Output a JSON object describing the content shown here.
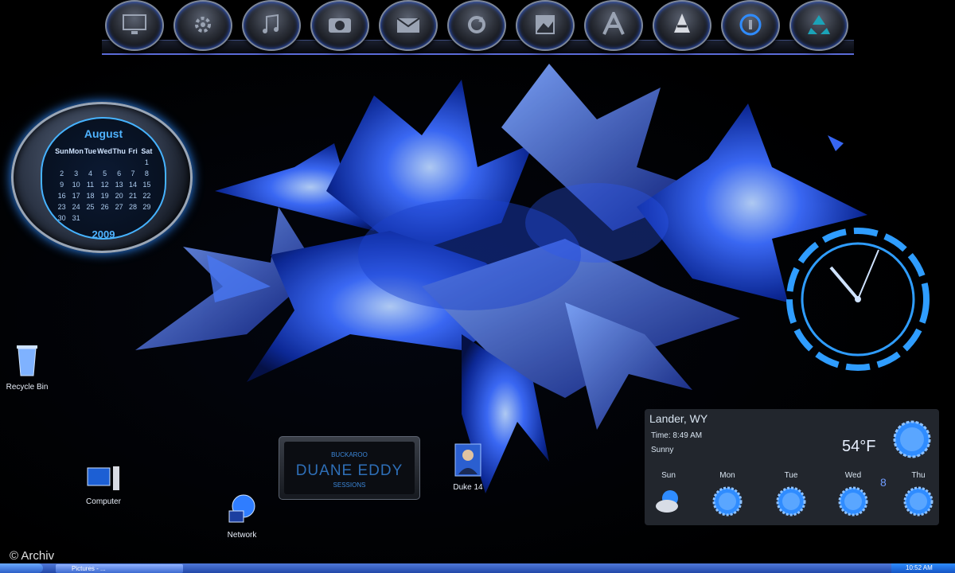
{
  "dock": {
    "items": [
      {
        "name": "monitor-icon"
      },
      {
        "name": "gear-icon"
      },
      {
        "name": "music-note-icon"
      },
      {
        "name": "camera-icon"
      },
      {
        "name": "mail-icon"
      },
      {
        "name": "refresh-icon"
      },
      {
        "name": "picture-icon"
      },
      {
        "name": "font-icon"
      },
      {
        "name": "vlc-cone-icon"
      },
      {
        "name": "info-icon"
      },
      {
        "name": "recycle-icon"
      }
    ]
  },
  "calendar": {
    "month": "August",
    "year": "2009",
    "weekdays": [
      "Sun",
      "Mon",
      "Tue",
      "Wed",
      "Thu",
      "Fri",
      "Sat"
    ],
    "days": [
      "",
      "",
      "",
      "",
      "",
      "",
      "1",
      "2",
      "3",
      "4",
      "5",
      "6",
      "7",
      "8",
      "9",
      "10",
      "11",
      "12",
      "13",
      "14",
      "15",
      "16",
      "17",
      "18",
      "19",
      "20",
      "21",
      "22",
      "23",
      "24",
      "25",
      "26",
      "27",
      "28",
      "29",
      "30",
      "31",
      "",
      "",
      "",
      "",
      ""
    ]
  },
  "desktop_icons": {
    "recycle_bin": "Recycle Bin",
    "computer": "Computer",
    "network": "Network",
    "duke": "Duke 14"
  },
  "nameplate": {
    "top": "BUCKAROO",
    "name": "DUANE EDDY",
    "bottom": "SESSIONS"
  },
  "weather": {
    "city": "Lander, WY",
    "time": "Time: 8:49 AM",
    "condition": "Sunny",
    "temperature": "54°F",
    "extra": "8",
    "forecast": [
      {
        "day": "Sun",
        "icon": "partly-cloudy-icon"
      },
      {
        "day": "Mon",
        "icon": "sun-icon"
      },
      {
        "day": "Tue",
        "icon": "sun-icon"
      },
      {
        "day": "Wed",
        "icon": "sun-icon"
      },
      {
        "day": "Thu",
        "icon": "sun-icon"
      }
    ]
  },
  "watermark": "© Archiv",
  "taskbar": {
    "task": "Pictures - ...",
    "clock": "10:52 AM"
  },
  "colors": {
    "accent": "#2f8cff",
    "background": "#000000",
    "taskbar": "#2147a8"
  }
}
